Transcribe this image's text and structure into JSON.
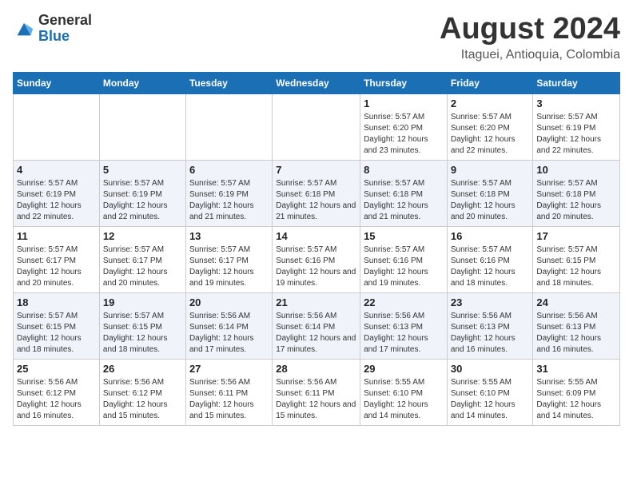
{
  "header": {
    "logo": {
      "general": "General",
      "blue": "Blue"
    },
    "title": "August 2024",
    "subtitle": "Itaguei, Antioquia, Colombia"
  },
  "weekdays": [
    "Sunday",
    "Monday",
    "Tuesday",
    "Wednesday",
    "Thursday",
    "Friday",
    "Saturday"
  ],
  "weeks": [
    [
      {
        "day": "",
        "sunrise": "",
        "sunset": "",
        "daylight": ""
      },
      {
        "day": "",
        "sunrise": "",
        "sunset": "",
        "daylight": ""
      },
      {
        "day": "",
        "sunrise": "",
        "sunset": "",
        "daylight": ""
      },
      {
        "day": "",
        "sunrise": "",
        "sunset": "",
        "daylight": ""
      },
      {
        "day": "1",
        "sunrise": "5:57 AM",
        "sunset": "6:20 PM",
        "daylight": "12 hours and 23 minutes."
      },
      {
        "day": "2",
        "sunrise": "5:57 AM",
        "sunset": "6:20 PM",
        "daylight": "12 hours and 22 minutes."
      },
      {
        "day": "3",
        "sunrise": "5:57 AM",
        "sunset": "6:19 PM",
        "daylight": "12 hours and 22 minutes."
      }
    ],
    [
      {
        "day": "4",
        "sunrise": "5:57 AM",
        "sunset": "6:19 PM",
        "daylight": "12 hours and 22 minutes."
      },
      {
        "day": "5",
        "sunrise": "5:57 AM",
        "sunset": "6:19 PM",
        "daylight": "12 hours and 22 minutes."
      },
      {
        "day": "6",
        "sunrise": "5:57 AM",
        "sunset": "6:19 PM",
        "daylight": "12 hours and 21 minutes."
      },
      {
        "day": "7",
        "sunrise": "5:57 AM",
        "sunset": "6:18 PM",
        "daylight": "12 hours and 21 minutes."
      },
      {
        "day": "8",
        "sunrise": "5:57 AM",
        "sunset": "6:18 PM",
        "daylight": "12 hours and 21 minutes."
      },
      {
        "day": "9",
        "sunrise": "5:57 AM",
        "sunset": "6:18 PM",
        "daylight": "12 hours and 20 minutes."
      },
      {
        "day": "10",
        "sunrise": "5:57 AM",
        "sunset": "6:18 PM",
        "daylight": "12 hours and 20 minutes."
      }
    ],
    [
      {
        "day": "11",
        "sunrise": "5:57 AM",
        "sunset": "6:17 PM",
        "daylight": "12 hours and 20 minutes."
      },
      {
        "day": "12",
        "sunrise": "5:57 AM",
        "sunset": "6:17 PM",
        "daylight": "12 hours and 20 minutes."
      },
      {
        "day": "13",
        "sunrise": "5:57 AM",
        "sunset": "6:17 PM",
        "daylight": "12 hours and 19 minutes."
      },
      {
        "day": "14",
        "sunrise": "5:57 AM",
        "sunset": "6:16 PM",
        "daylight": "12 hours and 19 minutes."
      },
      {
        "day": "15",
        "sunrise": "5:57 AM",
        "sunset": "6:16 PM",
        "daylight": "12 hours and 19 minutes."
      },
      {
        "day": "16",
        "sunrise": "5:57 AM",
        "sunset": "6:16 PM",
        "daylight": "12 hours and 18 minutes."
      },
      {
        "day": "17",
        "sunrise": "5:57 AM",
        "sunset": "6:15 PM",
        "daylight": "12 hours and 18 minutes."
      }
    ],
    [
      {
        "day": "18",
        "sunrise": "5:57 AM",
        "sunset": "6:15 PM",
        "daylight": "12 hours and 18 minutes."
      },
      {
        "day": "19",
        "sunrise": "5:57 AM",
        "sunset": "6:15 PM",
        "daylight": "12 hours and 18 minutes."
      },
      {
        "day": "20",
        "sunrise": "5:56 AM",
        "sunset": "6:14 PM",
        "daylight": "12 hours and 17 minutes."
      },
      {
        "day": "21",
        "sunrise": "5:56 AM",
        "sunset": "6:14 PM",
        "daylight": "12 hours and 17 minutes."
      },
      {
        "day": "22",
        "sunrise": "5:56 AM",
        "sunset": "6:13 PM",
        "daylight": "12 hours and 17 minutes."
      },
      {
        "day": "23",
        "sunrise": "5:56 AM",
        "sunset": "6:13 PM",
        "daylight": "12 hours and 16 minutes."
      },
      {
        "day": "24",
        "sunrise": "5:56 AM",
        "sunset": "6:13 PM",
        "daylight": "12 hours and 16 minutes."
      }
    ],
    [
      {
        "day": "25",
        "sunrise": "5:56 AM",
        "sunset": "6:12 PM",
        "daylight": "12 hours and 16 minutes."
      },
      {
        "day": "26",
        "sunrise": "5:56 AM",
        "sunset": "6:12 PM",
        "daylight": "12 hours and 15 minutes."
      },
      {
        "day": "27",
        "sunrise": "5:56 AM",
        "sunset": "6:11 PM",
        "daylight": "12 hours and 15 minutes."
      },
      {
        "day": "28",
        "sunrise": "5:56 AM",
        "sunset": "6:11 PM",
        "daylight": "12 hours and 15 minutes."
      },
      {
        "day": "29",
        "sunrise": "5:55 AM",
        "sunset": "6:10 PM",
        "daylight": "12 hours and 14 minutes."
      },
      {
        "day": "30",
        "sunrise": "5:55 AM",
        "sunset": "6:10 PM",
        "daylight": "12 hours and 14 minutes."
      },
      {
        "day": "31",
        "sunrise": "5:55 AM",
        "sunset": "6:09 PM",
        "daylight": "12 hours and 14 minutes."
      }
    ]
  ]
}
